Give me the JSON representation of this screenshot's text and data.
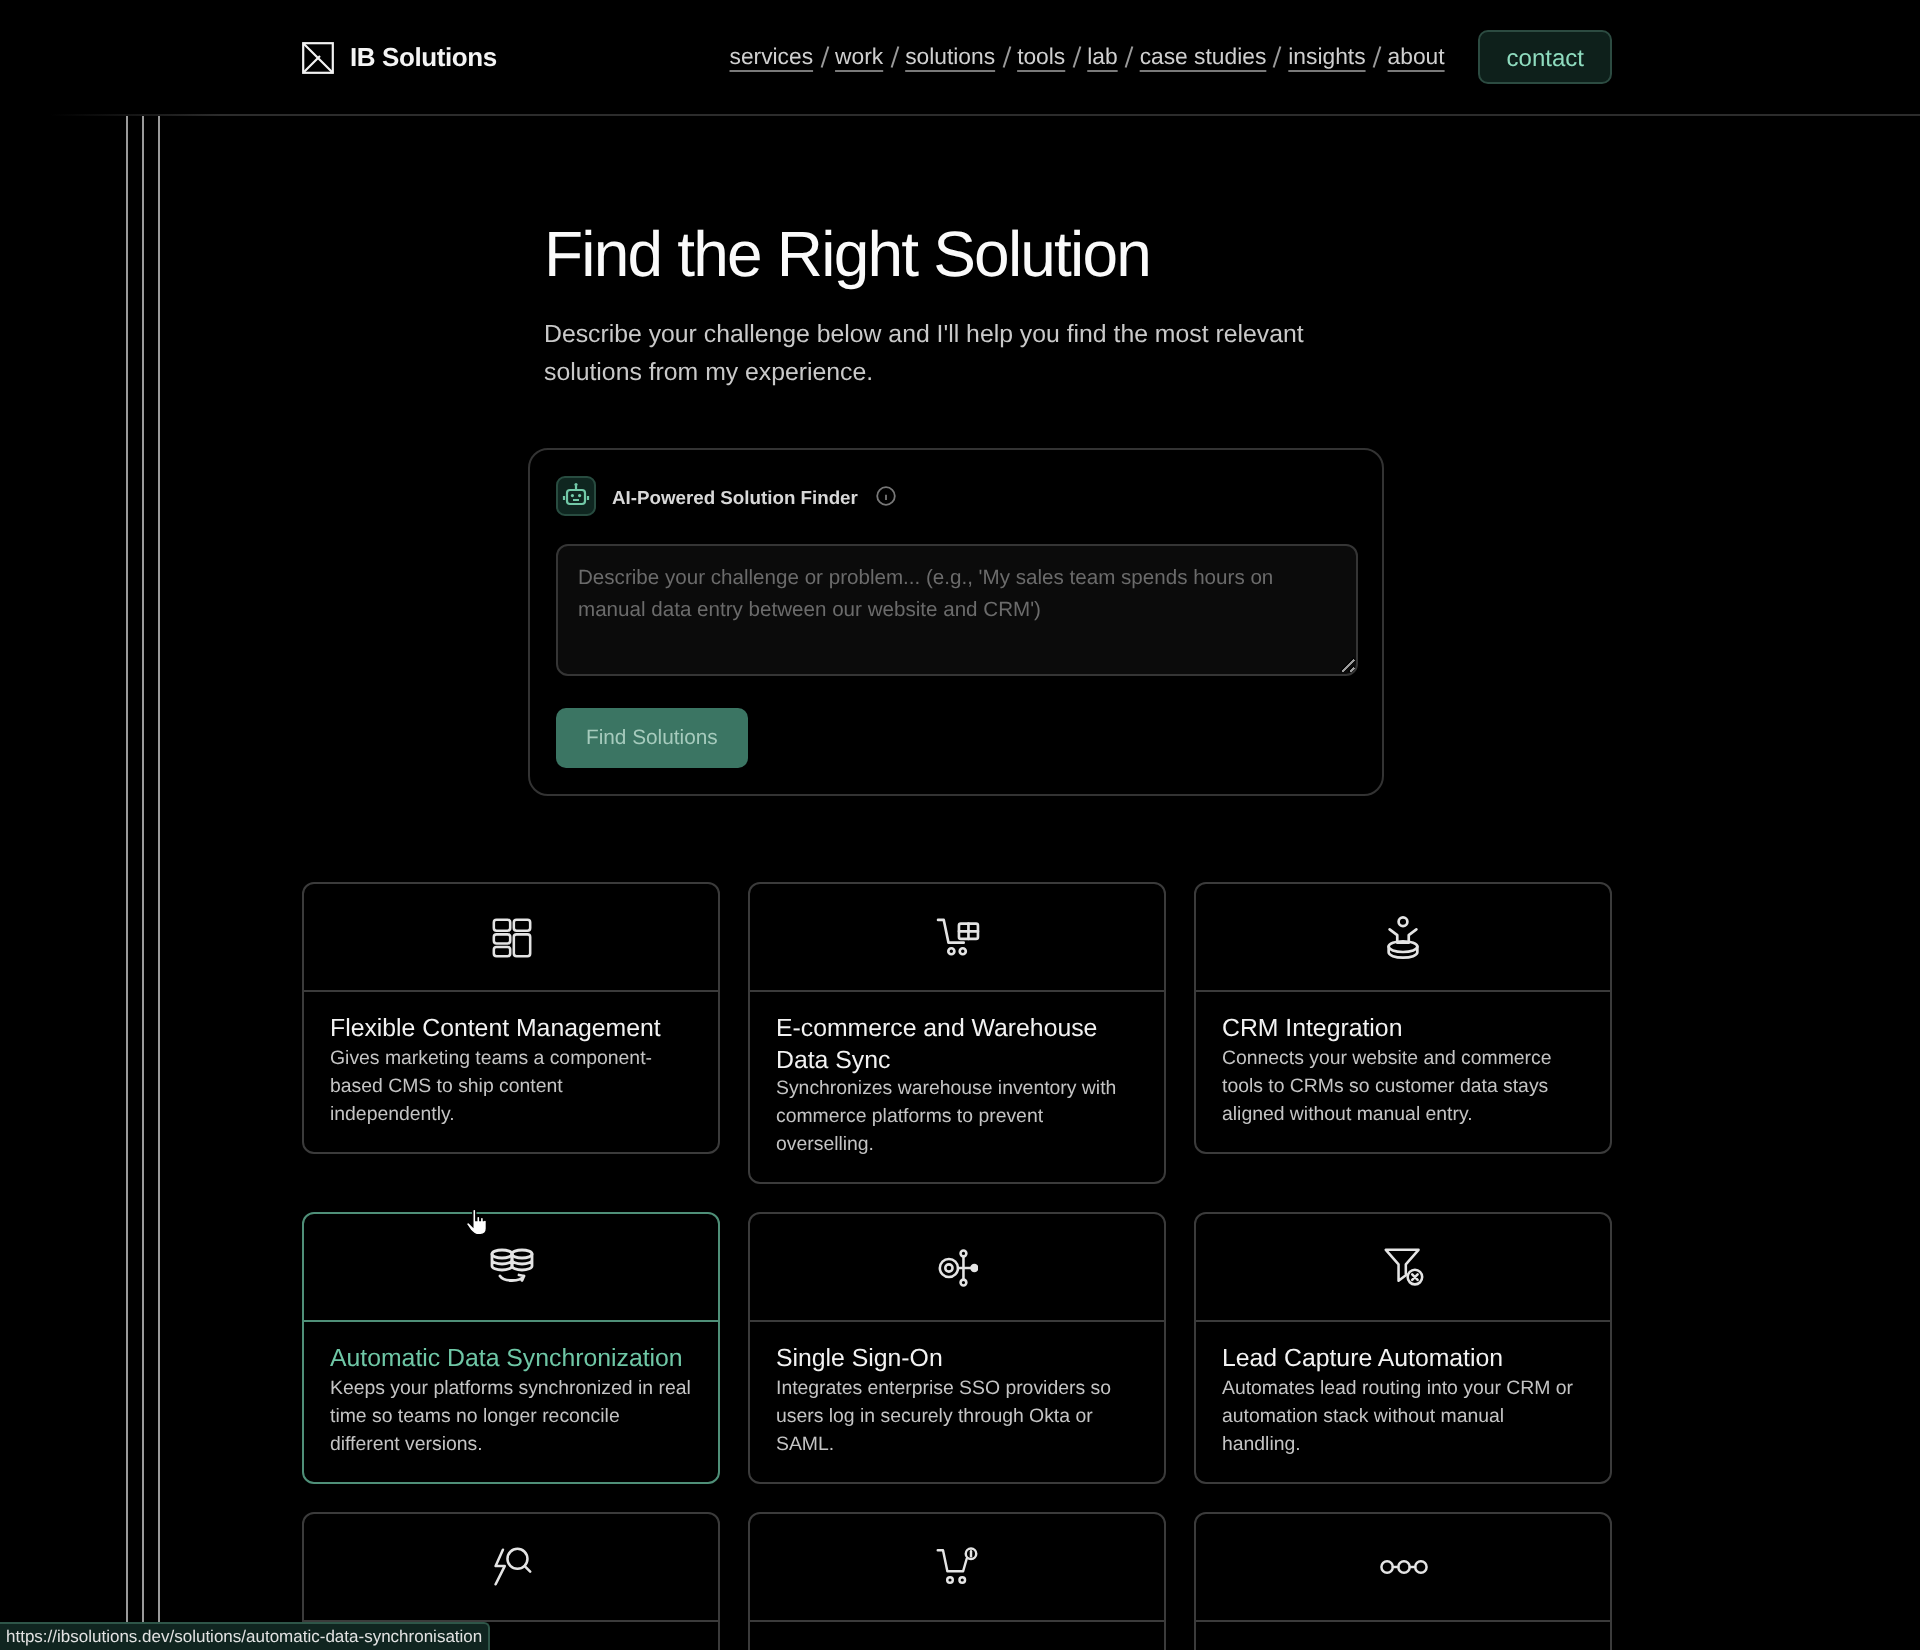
{
  "header": {
    "brand": "IB Solutions",
    "nav": [
      "services",
      "work",
      "solutions",
      "tools",
      "lab",
      "case studies",
      "insights",
      "about"
    ],
    "contact": "contact"
  },
  "hero": {
    "title": "Find the Right Solution",
    "intro": "Describe your challenge below and I'll help you find the most relevant solutions from my experience."
  },
  "finder": {
    "title": "AI-Powered Solution Finder",
    "placeholder": "Describe your challenge or problem... (e.g., 'My sales team spends hours on manual data entry between our website and CRM')",
    "button": {
      "label": "Find Solutions",
      "disabled": true
    }
  },
  "solutions": [
    {
      "title": "Flexible Content Management",
      "description": "Gives marketing teams a component-based CMS to ship content independently.",
      "highlighted": false
    },
    {
      "title": "E-commerce and Warehouse Data Sync",
      "description": "Synchronizes warehouse inventory with commerce platforms to prevent overselling.",
      "highlighted": false
    },
    {
      "title": "CRM Integration",
      "description": "Connects your website and commerce tools to CRMs so customer data stays aligned without manual entry.",
      "highlighted": false
    },
    {
      "title": "Automatic Data Synchronization",
      "description": "Keeps your platforms synchronized in real time so teams no longer reconcile different versions.",
      "highlighted": true
    },
    {
      "title": "Single Sign-On",
      "description": "Integrates enterprise SSO providers so users log in securely through Okta or SAML.",
      "highlighted": false
    },
    {
      "title": "Lead Capture Automation",
      "description": "Automates lead routing into your CRM or automation stack without manual handling.",
      "highlighted": false
    },
    {
      "highlighted": false
    },
    {
      "highlighted": false
    },
    {
      "highlighted": false
    }
  ],
  "status_bar": {
    "url": "https://ibsolutions.dev/solutions/automatic-data-synchronisation"
  }
}
